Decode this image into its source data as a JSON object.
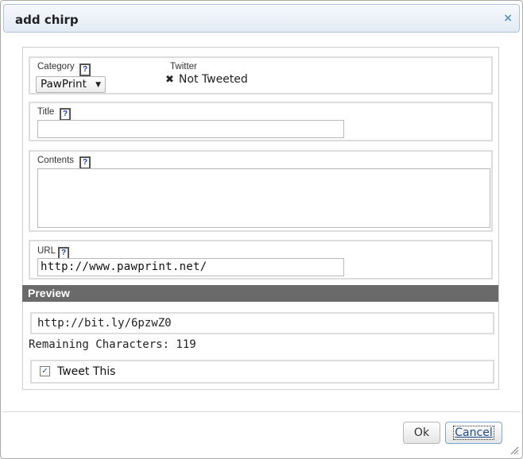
{
  "dialog": {
    "title": "add chirp",
    "close_glyph": "×"
  },
  "form": {
    "category": {
      "label": "Category",
      "help": "?",
      "selected": "PawPrint"
    },
    "twitter": {
      "label": "Twitter",
      "status_icon": "✖",
      "status": "Not Tweeted"
    },
    "title": {
      "label": "Title",
      "help": "?",
      "value": ""
    },
    "contents": {
      "label": "Contents",
      "help": "?",
      "value": ""
    },
    "url": {
      "label": "URL",
      "help": "?",
      "value": "http://www.pawprint.net/"
    }
  },
  "preview": {
    "heading": "Preview",
    "short_url": "http://bit.ly/6pzwZ0",
    "remaining": "Remaining Characters: 119",
    "tweet_this": {
      "label": "Tweet This",
      "checked": true,
      "check_glyph": "✓"
    }
  },
  "buttons": {
    "ok": "Ok",
    "cancel": "Cancel"
  },
  "colors": {
    "preview_bar": "#6a6a6a",
    "title_bar": "#e2ebf4",
    "close_icon": "#5a8fd0"
  }
}
